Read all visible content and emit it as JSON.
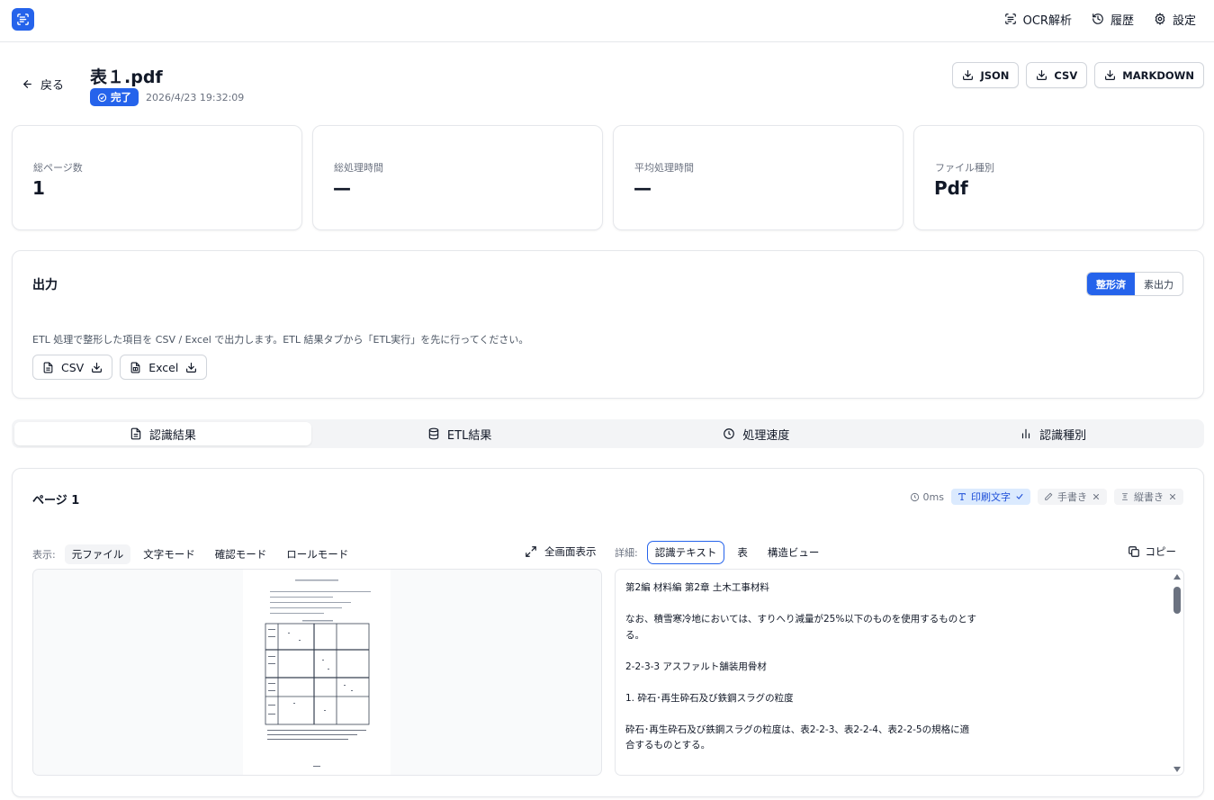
{
  "nav": {
    "items": [
      {
        "label": "OCR解析",
        "icon": "scan-icon"
      },
      {
        "label": "履歴",
        "icon": "history-icon"
      },
      {
        "label": "設定",
        "icon": "gear-icon"
      }
    ]
  },
  "header": {
    "back_label": "戻る",
    "title": "表１.pdf",
    "status": "完了",
    "timestamp": "2026/4/23 19:32:09",
    "exports": [
      "JSON",
      "CSV",
      "MARKDOWN"
    ]
  },
  "stats": [
    {
      "label": "総ページ数",
      "value": "1"
    },
    {
      "label": "総処理時間",
      "value": "—"
    },
    {
      "label": "平均処理時間",
      "value": "—"
    },
    {
      "label": "ファイル種別",
      "value": "Pdf"
    }
  ],
  "output": {
    "title": "出力",
    "toggle": [
      "整形済",
      "素出力"
    ],
    "description": "ETL 処理で整形した項目を CSV / Excel で出力します。ETL 結果タブから「ETL実行」を先に行ってください。",
    "buttons": [
      "CSV",
      "Excel"
    ]
  },
  "tabs": [
    {
      "label": "認識結果",
      "icon": "file-text-icon"
    },
    {
      "label": "ETL結果",
      "icon": "database-icon"
    },
    {
      "label": "処理速度",
      "icon": "clock-icon"
    },
    {
      "label": "認識種別",
      "icon": "bar-chart-icon"
    }
  ],
  "page": {
    "title": "ページ 1",
    "time": "0ms",
    "chips": [
      "印刷文字",
      "手書き",
      "縦書き"
    ],
    "view_label": "表示:",
    "view_modes": [
      "元ファイル",
      "文字モード",
      "確認モード",
      "ロールモード"
    ],
    "fullscreen": "全画面表示",
    "detail_label": "詳細:",
    "detail_tabs": [
      "認識テキスト",
      "表",
      "構造ビュー"
    ],
    "copy": "コピー",
    "text": "第2編 材料編 第2章 土木工事材料\n\nなお、積雪寒冷地においては、すりへり減量が25%以下のものを使用するものとす\nる。\n\n2-2-3-3 アスファルト舗装用骨材\n\n1. 砕石･再生砕石及び鉄鋼スラグの粒度\n\n砕石･再生砕石及び鉄鋼スラグの粒度は、表2-2-3、表2-2-4、表2-2-5の規格に適\n合するものとする。\n\n\n"
  },
  "colors": {
    "accent": "#2563eb"
  }
}
